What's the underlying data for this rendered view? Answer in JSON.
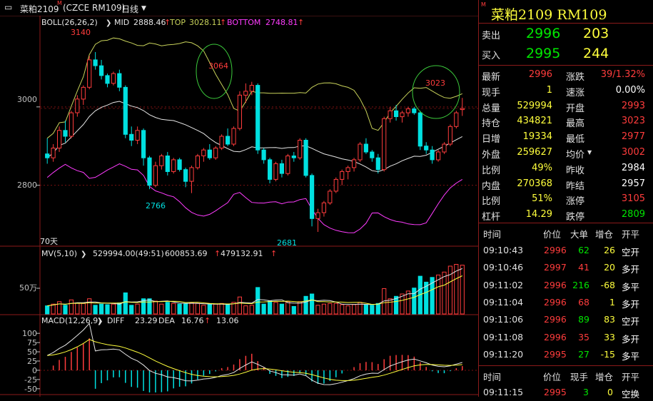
{
  "header": {
    "symbol_name": "菜粕2109",
    "symbol_code": "(CZCE RM109)",
    "period": "日线",
    "period_arrow": "▼"
  },
  "chart_data": [
    {
      "type": "candlestick",
      "title": "BOLL(26,26,2)",
      "indicators": {
        "MID": "2888.46",
        "TOP": "3028.11",
        "BOTTOM": "2748.81"
      },
      "ylabels": [
        "3000",
        "2800"
      ],
      "ylim": [
        2650,
        3200
      ],
      "annotations": [
        "3140",
        "3064",
        "3023",
        "2766",
        "2681"
      ],
      "bar_count_label": "70天",
      "candles": [
        [
          2880,
          2920,
          2855,
          2870
        ],
        [
          2870,
          2905,
          2860,
          2895
        ],
        [
          2895,
          2950,
          2885,
          2940
        ],
        [
          2940,
          2965,
          2910,
          2925
        ],
        [
          2925,
          2990,
          2920,
          2985
        ],
        [
          2985,
          3030,
          2975,
          3020
        ],
        [
          3020,
          3055,
          3005,
          3050
        ],
        [
          3050,
          3130,
          3045,
          3120
        ],
        [
          3120,
          3140,
          3095,
          3105
        ],
        [
          3105,
          3120,
          3070,
          3080
        ],
        [
          3080,
          3085,
          3050,
          3060
        ],
        [
          3060,
          3090,
          3055,
          3085
        ],
        [
          3085,
          3095,
          3040,
          3050
        ],
        [
          3050,
          3055,
          2920,
          2930
        ],
        [
          2930,
          2950,
          2900,
          2915
        ],
        [
          2915,
          2950,
          2905,
          2940
        ],
        [
          2940,
          2945,
          2850,
          2870
        ],
        [
          2870,
          2875,
          2790,
          2800
        ],
        [
          2800,
          2860,
          2795,
          2850
        ],
        [
          2850,
          2880,
          2840,
          2875
        ],
        [
          2875,
          2885,
          2825,
          2835
        ],
        [
          2835,
          2870,
          2830,
          2865
        ],
        [
          2865,
          2870,
          2835,
          2840
        ],
        [
          2840,
          2845,
          2795,
          2810
        ],
        [
          2810,
          2850,
          2780,
          2845
        ],
        [
          2845,
          2880,
          2840,
          2875
        ],
        [
          2875,
          2895,
          2860,
          2890
        ],
        [
          2890,
          2905,
          2865,
          2870
        ],
        [
          2870,
          2900,
          2865,
          2895
        ],
        [
          2895,
          2930,
          2890,
          2925
        ],
        [
          2925,
          2945,
          2900,
          2905
        ],
        [
          2905,
          2950,
          2900,
          2945
        ],
        [
          2945,
          3040,
          2940,
          3030
        ],
        [
          3030,
          3060,
          3010,
          3040
        ],
        [
          3040,
          3064,
          3030,
          3055
        ],
        [
          3055,
          3060,
          2880,
          2890
        ],
        [
          2890,
          2895,
          2855,
          2865
        ],
        [
          2865,
          2870,
          2805,
          2815
        ],
        [
          2815,
          2860,
          2810,
          2855
        ],
        [
          2855,
          2865,
          2820,
          2830
        ],
        [
          2830,
          2880,
          2825,
          2875
        ],
        [
          2875,
          2885,
          2860,
          2870
        ],
        [
          2870,
          2920,
          2865,
          2915
        ],
        [
          2915,
          2920,
          2820,
          2825
        ],
        [
          2825,
          2830,
          2695,
          2715
        ],
        [
          2715,
          2740,
          2681,
          2730
        ],
        [
          2730,
          2760,
          2720,
          2755
        ],
        [
          2755,
          2790,
          2750,
          2785
        ],
        [
          2785,
          2820,
          2780,
          2815
        ],
        [
          2815,
          2840,
          2800,
          2835
        ],
        [
          2835,
          2850,
          2815,
          2845
        ],
        [
          2845,
          2870,
          2835,
          2865
        ],
        [
          2865,
          2910,
          2860,
          2905
        ],
        [
          2905,
          2920,
          2880,
          2885
        ],
        [
          2885,
          2890,
          2860,
          2870
        ],
        [
          2870,
          2880,
          2830,
          2840
        ],
        [
          2840,
          2975,
          2835,
          2970
        ],
        [
          2970,
          3000,
          2960,
          2990
        ],
        [
          2990,
          3005,
          2965,
          2975
        ],
        [
          2975,
          2990,
          2960,
          2985
        ],
        [
          2985,
          3000,
          2975,
          2995
        ],
        [
          2995,
          3000,
          2980,
          2985
        ],
        [
          2985,
          2990,
          2890,
          2900
        ],
        [
          2900,
          2910,
          2880,
          2890
        ],
        [
          2890,
          2900,
          2855,
          2865
        ],
        [
          2865,
          2890,
          2860,
          2885
        ],
        [
          2885,
          2910,
          2880,
          2905
        ],
        [
          2905,
          2955,
          2900,
          2950
        ],
        [
          2950,
          2990,
          2945,
          2985
        ],
        [
          2993,
          3023,
          2977,
          2996
        ]
      ],
      "volume": {
        "title": "MV(5,10)",
        "value": "529994.00(49:51)",
        "ma5": "600853.69",
        "ma10": "479132.91",
        "ylabel": "50万"
      },
      "macd": {
        "title": "MACD(12,26,9)",
        "diff": "23.29",
        "dea": "16.76",
        "macd": "13.06",
        "ylabels": [
          "100",
          "75",
          "50",
          "25",
          "0",
          "-25",
          "-50"
        ]
      }
    }
  ],
  "quote": {
    "title": "菜粕2109  RM109",
    "ask_label": "卖出",
    "ask_price": "2996",
    "ask_vol": "203",
    "bid_label": "买入",
    "bid_price": "2995",
    "bid_vol": "244",
    "rows": [
      {
        "l1": "最新",
        "v1": "2996",
        "c1": "red",
        "l2": "涨跌",
        "v2": "39/1.32%",
        "c2": "red"
      },
      {
        "l1": "现手",
        "v1": "1",
        "c1": "yel",
        "l2": "速涨",
        "v2": "0.00%",
        "c2": "wht"
      },
      {
        "l1": "总量",
        "v1": "529994",
        "c1": "yel",
        "l2": "开盘",
        "v2": "2993",
        "c2": "red"
      },
      {
        "l1": "持仓",
        "v1": "434821",
        "c1": "yel",
        "l2": "最高",
        "v2": "3023",
        "c2": "red"
      },
      {
        "l1": "日增",
        "v1": "19334",
        "c1": "yel",
        "l2": "最低",
        "v2": "2977",
        "c2": "red"
      },
      {
        "l1": "外盘",
        "v1": "259627",
        "c1": "yel",
        "l2": "均价",
        "v2": "3002",
        "c2": "red"
      },
      {
        "l1": "比例",
        "v1": "49%",
        "c1": "yel",
        "l2": "昨收",
        "v2": "2984",
        "c2": "wht"
      },
      {
        "l1": "内盘",
        "v1": "270368",
        "c1": "yel",
        "l2": "昨结",
        "v2": "2957",
        "c2": "wht"
      },
      {
        "l1": "比例",
        "v1": "51%",
        "c1": "yel",
        "l2": "涨停",
        "v2": "3105",
        "c2": "red"
      },
      {
        "l1": "杠杆",
        "v1": "14.29",
        "c1": "yel",
        "l2": "跌停",
        "v2": "2809",
        "c2": "grn"
      }
    ]
  },
  "ticks": {
    "headers": [
      "时间",
      "价位",
      "大单",
      "增仓",
      "开平"
    ],
    "rows": [
      {
        "time": "09:10:43",
        "price": "2996",
        "vol": "62",
        "chg": "26",
        "type": "空开",
        "vc": "grn",
        "cc": "yel",
        "tc": "wht"
      },
      {
        "time": "09:10:46",
        "price": "2997",
        "vol": "41",
        "chg": "20",
        "type": "多开",
        "vc": "red",
        "cc": "yel",
        "tc": "wht"
      },
      {
        "time": "09:11:02",
        "price": "2996",
        "vol": "216",
        "chg": "-68",
        "type": "多平",
        "vc": "grn",
        "cc": "yel",
        "tc": "wht"
      },
      {
        "time": "09:11:04",
        "price": "2996",
        "vol": "68",
        "chg": "1",
        "type": "多开",
        "vc": "red",
        "cc": "yel",
        "tc": "wht"
      },
      {
        "time": "09:11:06",
        "price": "2996",
        "vol": "89",
        "chg": "83",
        "type": "空开",
        "vc": "grn",
        "cc": "yel",
        "tc": "wht"
      },
      {
        "time": "09:11:08",
        "price": "2996",
        "vol": "35",
        "chg": "33",
        "type": "多开",
        "vc": "red",
        "cc": "yel",
        "tc": "wht"
      },
      {
        "time": "09:11:20",
        "price": "2995",
        "vol": "27",
        "chg": "-15",
        "type": "多平",
        "vc": "grn",
        "cc": "yel",
        "tc": "wht"
      }
    ]
  },
  "ticks2": {
    "headers": [
      "时间",
      "价位",
      "现手",
      "增仓",
      "开平"
    ],
    "row": {
      "time": "09:11:15",
      "price": "2995",
      "vol": "3",
      "chg": "0",
      "type": "空换"
    }
  },
  "colors": {
    "up": "#ff3c3c",
    "down": "#00e0e0",
    "mid": "#e6e6e6",
    "top": "#c8d25a",
    "bottom": "#ff3cff",
    "grid": "#7a1010"
  }
}
